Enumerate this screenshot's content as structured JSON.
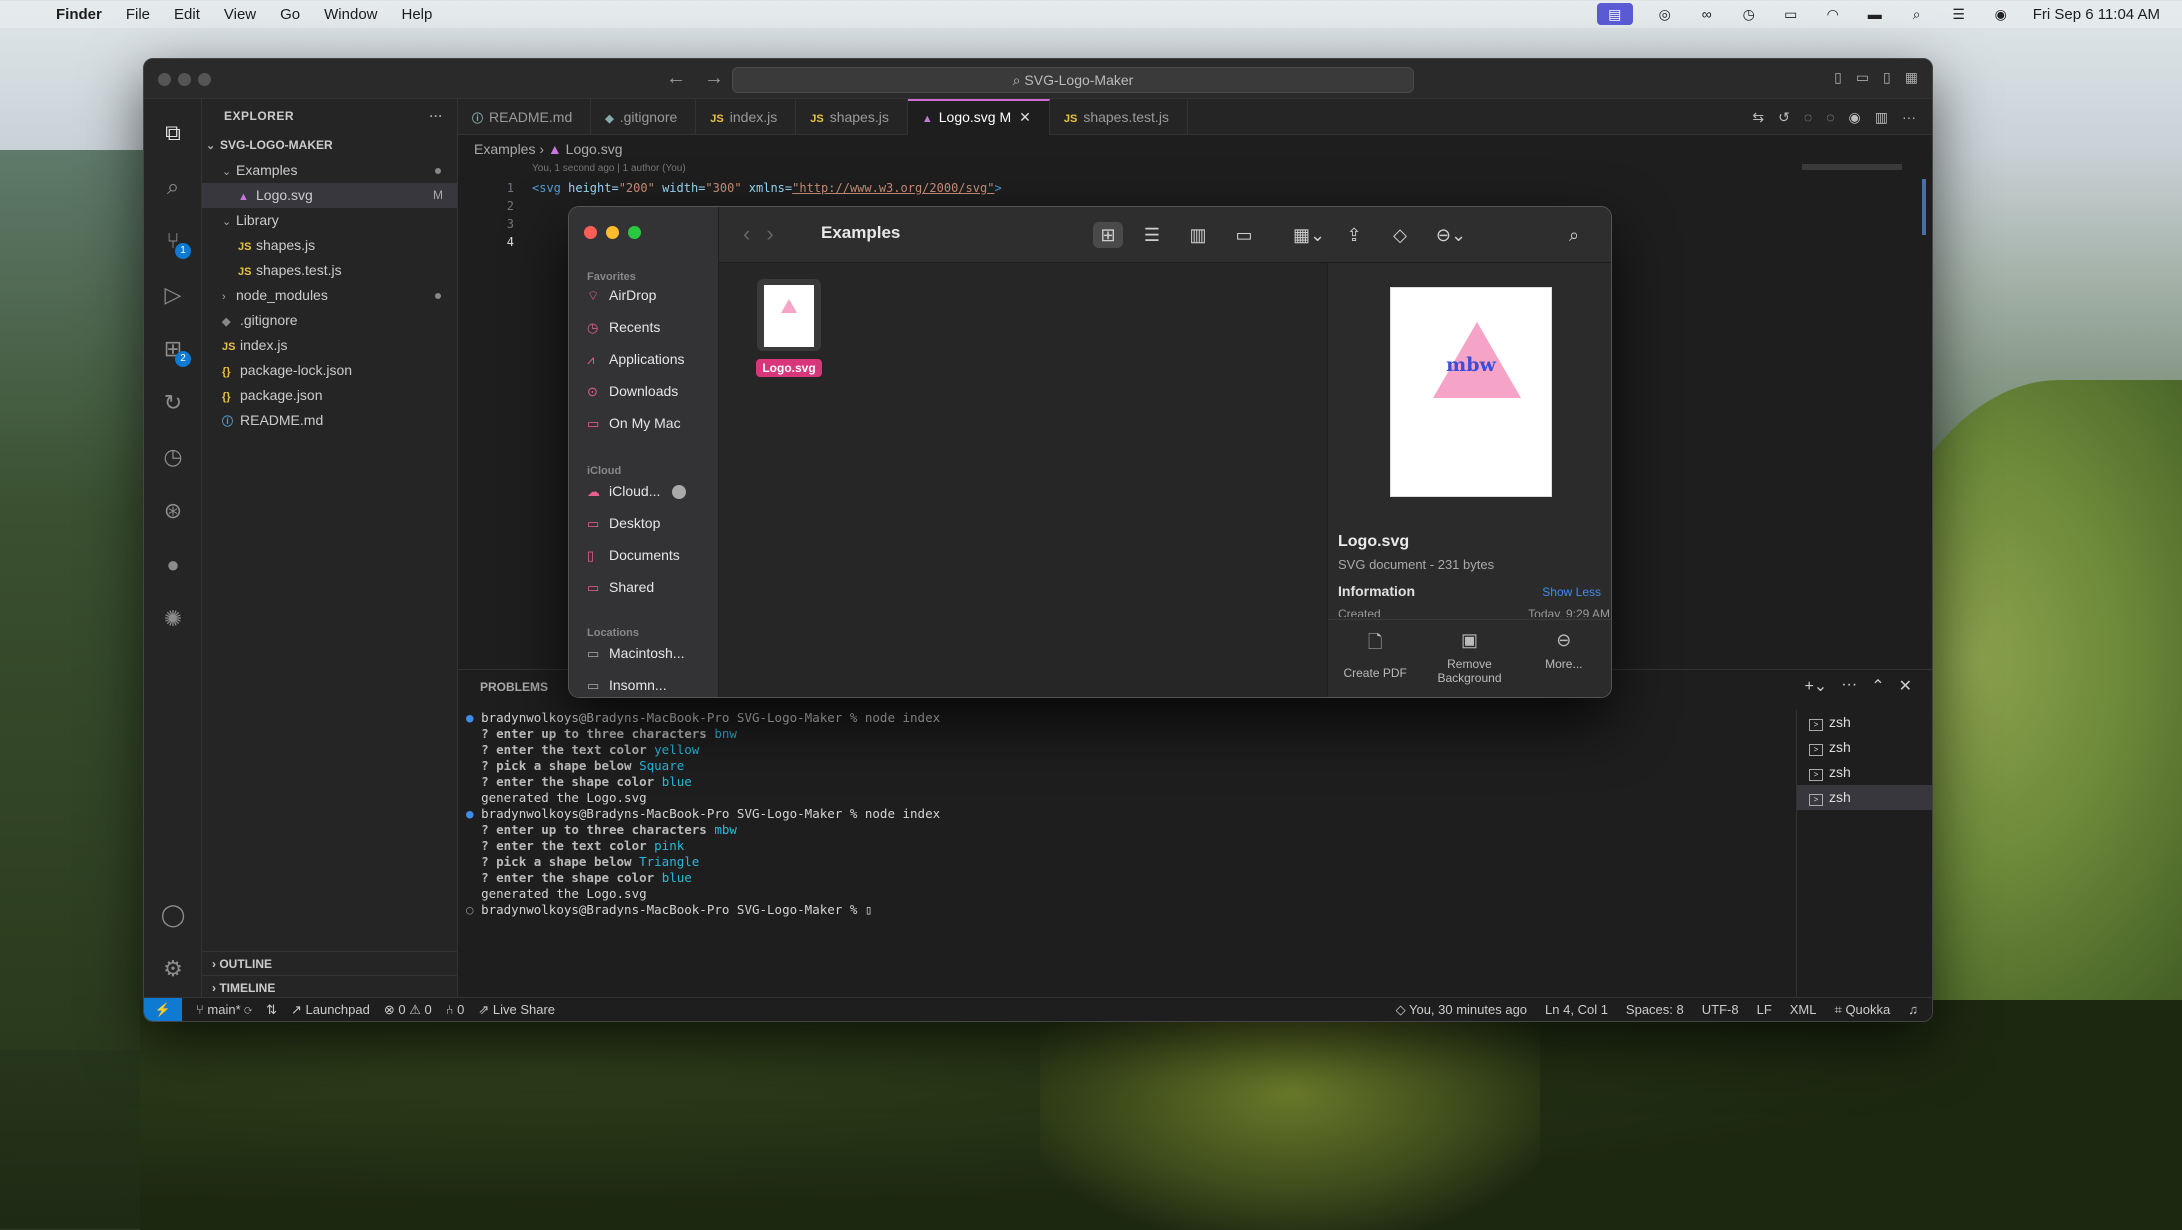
{
  "menubar": {
    "app": "Finder",
    "menus": [
      "File",
      "Edit",
      "View",
      "Go",
      "Window",
      "Help"
    ],
    "clock": "Fri Sep 6  11:04 AM"
  },
  "vscode": {
    "command_center": "SVG-Logo-Maker",
    "explorer_title": "EXPLORER",
    "project": "SVG-LOGO-MAKER",
    "tree": [
      {
        "label": "Examples",
        "kind": "folder-open",
        "indent": 1,
        "dot": true
      },
      {
        "label": "Logo.svg",
        "kind": "svg",
        "indent": 2,
        "mark": "M",
        "selected": true
      },
      {
        "label": "Library",
        "kind": "folder-open",
        "indent": 1
      },
      {
        "label": "shapes.js",
        "kind": "js",
        "indent": 2
      },
      {
        "label": "shapes.test.js",
        "kind": "js",
        "indent": 2
      },
      {
        "label": "node_modules",
        "kind": "folder",
        "indent": 1,
        "dot": true
      },
      {
        "label": ".gitignore",
        "kind": "git",
        "indent": 1
      },
      {
        "label": "index.js",
        "kind": "js",
        "indent": 1
      },
      {
        "label": "package-lock.json",
        "kind": "json",
        "indent": 1
      },
      {
        "label": "package.json",
        "kind": "json",
        "indent": 1
      },
      {
        "label": "README.md",
        "kind": "info",
        "indent": 1
      }
    ],
    "outline_label": "OUTLINE",
    "timeline_label": "TIMELINE",
    "tabs": [
      {
        "label": "README.md",
        "icon": "ⓘ"
      },
      {
        "label": ".gitignore",
        "icon": "◆"
      },
      {
        "label": "index.js",
        "icon": "JS"
      },
      {
        "label": "shapes.js",
        "icon": "JS"
      },
      {
        "label": "Logo.svg M",
        "icon": "▲",
        "active": true
      },
      {
        "label": "shapes.test.js",
        "icon": "JS"
      }
    ],
    "breadcrumb": {
      "folder": "Examples",
      "file": "Logo.svg"
    },
    "blame_line": "You, 1 second ago | 1 author (You)",
    "line_numbers": [
      "1",
      "2",
      "3",
      "4"
    ],
    "code": {
      "open": "<svg ",
      "a1": "height=",
      "v1": "\"200\" ",
      "a2": "width=",
      "v2": "\"300\" ",
      "a3": "xmlns=",
      "v3": "\"http://www.w3.org/2000/svg\"",
      "close": ">"
    },
    "panel_tab": "PROBLEMS",
    "terminal_lines": [
      {
        "type": "prompt",
        "dot": "●",
        "text": "bradynwolkoys@Bradyns-MacBook-Pro SVG-Logo-Maker % node index"
      },
      {
        "type": "qa",
        "q": "? enter up to three characters ",
        "a": "bnw"
      },
      {
        "type": "qa",
        "q": "? enter the text color ",
        "a": "yellow"
      },
      {
        "type": "qa",
        "q": "? pick a shape below ",
        "a": "Square"
      },
      {
        "type": "qa",
        "q": "? enter the shape color ",
        "a": "blue"
      },
      {
        "type": "out",
        "text": "generated the Logo.svg"
      },
      {
        "type": "prompt",
        "dot": "●",
        "text": "bradynwolkoys@Bradyns-MacBook-Pro SVG-Logo-Maker % node index"
      },
      {
        "type": "qa",
        "q": "? enter up to three characters ",
        "a": "mbw"
      },
      {
        "type": "qa",
        "q": "? enter the text color ",
        "a": "pink"
      },
      {
        "type": "qa",
        "q": "? pick a shape below ",
        "a": "Triangle"
      },
      {
        "type": "qa",
        "q": "? enter the shape color ",
        "a": "blue"
      },
      {
        "type": "out",
        "text": "generated the Logo.svg"
      },
      {
        "type": "prompt",
        "dot": "○",
        "text": "bradynwolkoys@Bradyns-MacBook-Pro SVG-Logo-Maker % ▯"
      }
    ],
    "terminals": [
      "zsh",
      "zsh",
      "zsh",
      "zsh"
    ],
    "status": {
      "branch": "main*",
      "launchpad": "Launchpad",
      "problems": "⊗ 0 ⚠ 0",
      "ports": "⑃ 0",
      "liveshare": "Live Share",
      "blame": "You, 30 minutes ago",
      "position": "Ln 4, Col 1",
      "spaces": "Spaces: 8",
      "encoding": "UTF-8",
      "eol": "LF",
      "language": "XML",
      "quokka": "Quokka"
    }
  },
  "finder": {
    "title": "Examples",
    "sections": {
      "favorites": "Favorites",
      "icloud": "iCloud",
      "locations": "Locations"
    },
    "favorites": [
      {
        "label": "AirDrop",
        "icon": "⌔"
      },
      {
        "label": "Recents",
        "icon": "◷"
      },
      {
        "label": "Applications",
        "icon": "⩘"
      },
      {
        "label": "Downloads",
        "icon": "⊙"
      },
      {
        "label": "On My Mac",
        "icon": "▭"
      }
    ],
    "icloud": [
      {
        "label": "iCloud...",
        "icon": "☁"
      },
      {
        "label": "Desktop",
        "icon": "▭"
      },
      {
        "label": "Documents",
        "icon": "▯"
      },
      {
        "label": "Shared",
        "icon": "▭"
      }
    ],
    "locations": [
      {
        "label": "Macintosh...",
        "icon": "▭"
      },
      {
        "label": "Insomn...",
        "icon": "▭"
      }
    ],
    "file": {
      "name": "Logo.svg"
    },
    "preview": {
      "logo_text": "mbw",
      "name": "Logo.svg",
      "kind": "SVG document - 231 bytes",
      "info_label": "Information",
      "show_less": "Show Less",
      "created_label": "Created",
      "created_value": "Today, 9:29 AM",
      "actions": [
        {
          "label": "Create PDF",
          "icon": "🗋"
        },
        {
          "label": "Remove Background",
          "icon": "▣"
        },
        {
          "label": "More...",
          "icon": "⊖"
        }
      ]
    }
  }
}
